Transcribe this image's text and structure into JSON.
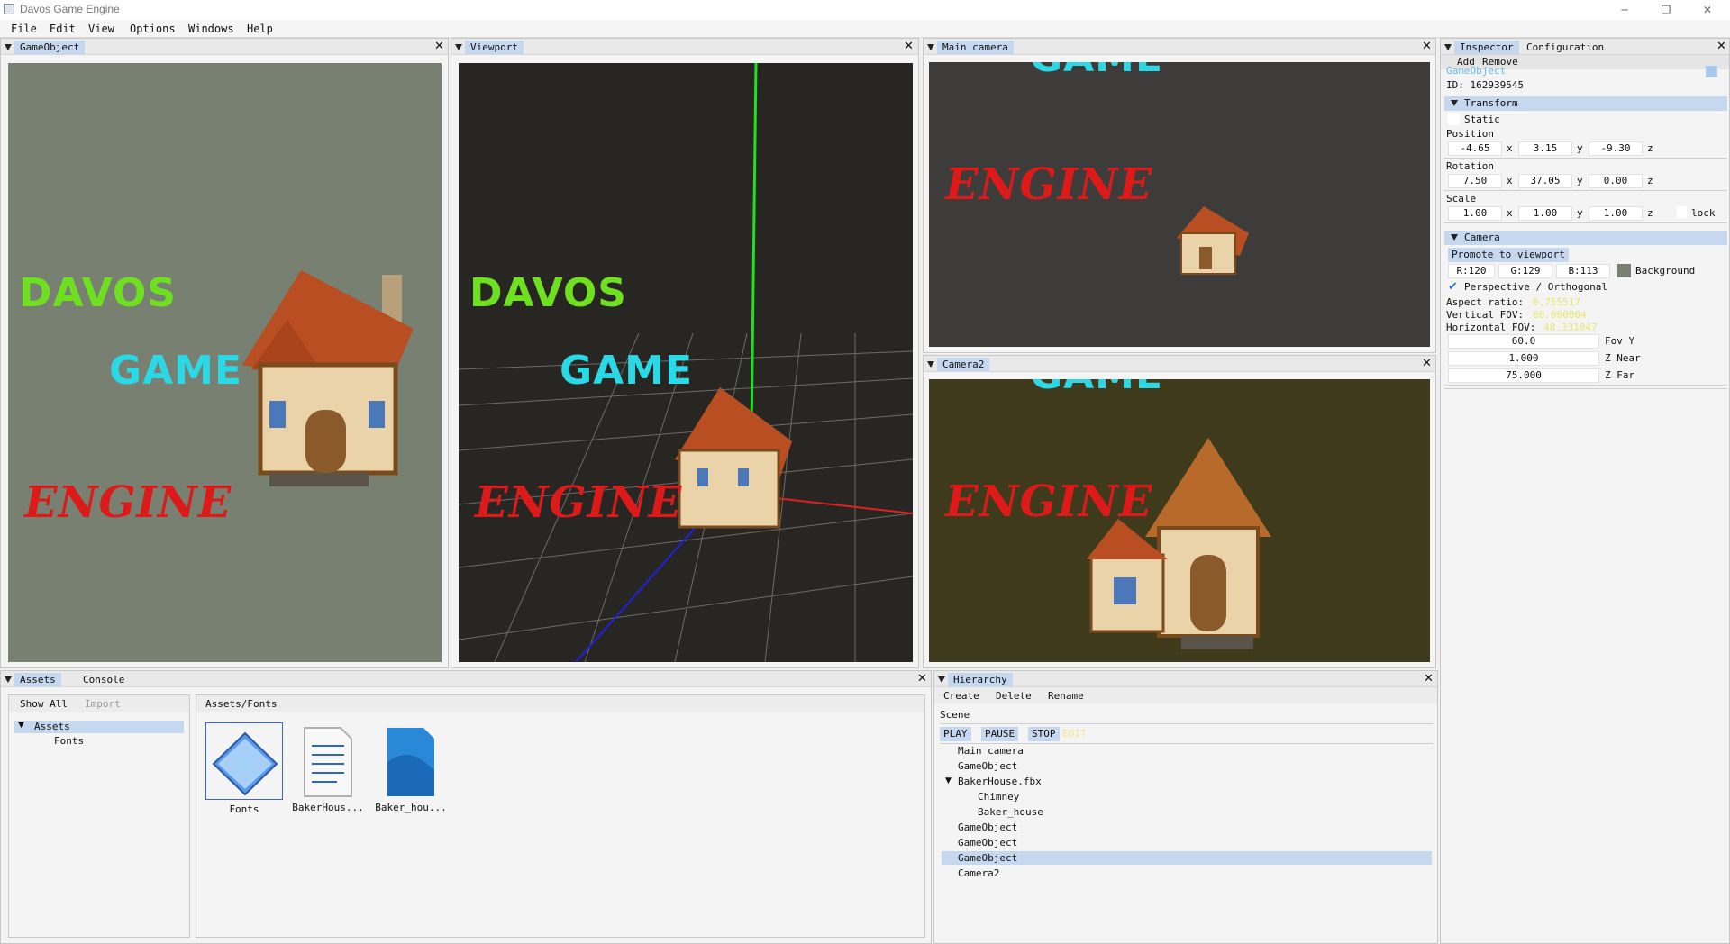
{
  "window": {
    "title": "Davos Game Engine",
    "minimize": "─",
    "restore": "❐",
    "close": "✕"
  },
  "menu": [
    "File",
    "Edit",
    "View",
    "Options",
    "Windows",
    "Help"
  ],
  "panels": {
    "gameobject": {
      "tab": "GameObject"
    },
    "viewport": {
      "tab": "Viewport"
    },
    "main_camera": {
      "tab": "Main camera"
    },
    "camera2": {
      "tab": "Camera2"
    }
  },
  "scene_text": {
    "davos": "DAVOS",
    "game": "GAME",
    "engine": "ENGINE"
  },
  "inspector": {
    "tabs": [
      "Inspector",
      "Configuration"
    ],
    "actions": [
      "Add",
      "Remove"
    ],
    "object_name": "GameObject",
    "id_label": "ID: 162939545",
    "transform": {
      "header": "Transform",
      "static_label": "Static",
      "position_label": "Position",
      "position": [
        "-4.65",
        "3.15",
        "-9.30"
      ],
      "rotation_label": "Rotation",
      "rotation": [
        "7.50",
        "37.05",
        "0.00"
      ],
      "scale_label": "Scale",
      "scale": [
        "1.00",
        "1.00",
        "1.00"
      ],
      "axes": [
        "x",
        "y",
        "z"
      ],
      "lock_label": "lock"
    },
    "camera": {
      "header": "Camera",
      "promote_label": "Promote to viewport",
      "r": "R:120",
      "g": "G:129",
      "b": "B:113",
      "background_label": "Background",
      "background_color": "#788171",
      "projection_label": "Perspective / Orthogonal",
      "aspect_label": "Aspect ratio:",
      "aspect_value": "0.755517",
      "vfov_label": "Vertical FOV:",
      "vfov_value": "60.000004",
      "hfov_label": "Horizontal FOV:",
      "hfov_value": "48.331047",
      "fov_y_value": "60.0",
      "fov_y_label": "Fov Y",
      "z_near_value": "1.000",
      "z_near_label": "Z Near",
      "z_far_value": "75.000",
      "z_far_label": "Z Far"
    }
  },
  "assets": {
    "tabs": [
      "Assets",
      "Console"
    ],
    "show_all": "Show All",
    "import": "Import",
    "tree_root": "Assets",
    "tree_child": "Fonts",
    "path": "Assets/Fonts",
    "items": [
      {
        "label": "Fonts",
        "icon": "folder-icon"
      },
      {
        "label": "BakerHous...",
        "icon": "text-file-icon"
      },
      {
        "label": "Baker_hou...",
        "icon": "image-file-icon"
      }
    ]
  },
  "hierarchy": {
    "tab": "Hierarchy",
    "actions": [
      "Create",
      "Delete",
      "Rename"
    ],
    "scene_label": "Scene",
    "play": "PLAY",
    "pause": "PAUSE",
    "stop": "STOP",
    "edit": "EDIT",
    "items": [
      "Main camera",
      "GameObject",
      "BakerHouse.fbx",
      "Chimney",
      "Baker_house",
      "GameObject",
      "GameObject",
      "GameObject",
      "Camera2"
    ]
  },
  "colors": {
    "gameobject_bg": "#788171",
    "viewport_bg": "#272622",
    "main_camera_bg": "#3d3c3a",
    "camera2_bg": "#3f3a1c",
    "selection": "#c6d8f0"
  }
}
